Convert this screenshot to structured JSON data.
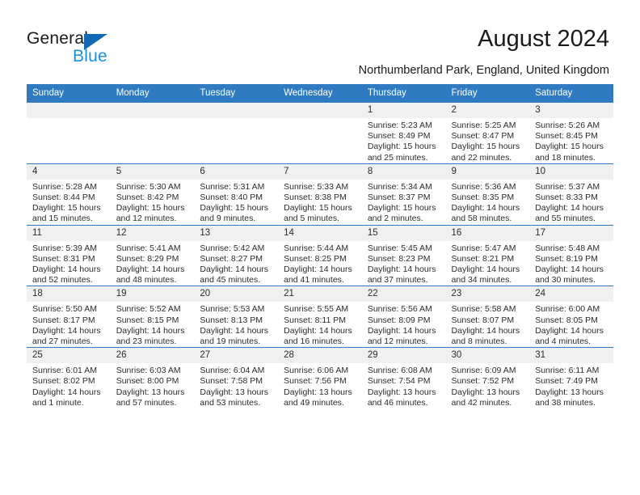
{
  "brand": {
    "word1": "General",
    "word2": "Blue",
    "triangle_color": "#1268b3",
    "blue_color": "#1a8fe0"
  },
  "header": {
    "title": "August 2024",
    "subtitle": "Northumberland Park, England, United Kingdom"
  },
  "theme": {
    "header_blue": "#2f7ac0",
    "daynum_gray": "#f0f0f0",
    "text": "#2b2b2b"
  },
  "calendar": {
    "weekday_headers": [
      "Sunday",
      "Monday",
      "Tuesday",
      "Wednesday",
      "Thursday",
      "Friday",
      "Saturday"
    ],
    "labels": {
      "sunrise": "Sunrise:",
      "sunset": "Sunset:",
      "daylight": "Daylight:"
    },
    "weeks": [
      [
        {
          "day": "",
          "empty": true
        },
        {
          "day": "",
          "empty": true
        },
        {
          "day": "",
          "empty": true
        },
        {
          "day": "",
          "empty": true
        },
        {
          "day": "1",
          "sunrise": "Sunrise: 5:23 AM",
          "sunset": "Sunset: 8:49 PM",
          "daylight_l1": "Daylight: 15 hours",
          "daylight_l2": "and 25 minutes."
        },
        {
          "day": "2",
          "sunrise": "Sunrise: 5:25 AM",
          "sunset": "Sunset: 8:47 PM",
          "daylight_l1": "Daylight: 15 hours",
          "daylight_l2": "and 22 minutes."
        },
        {
          "day": "3",
          "sunrise": "Sunrise: 5:26 AM",
          "sunset": "Sunset: 8:45 PM",
          "daylight_l1": "Daylight: 15 hours",
          "daylight_l2": "and 18 minutes."
        }
      ],
      [
        {
          "day": "4",
          "sunrise": "Sunrise: 5:28 AM",
          "sunset": "Sunset: 8:44 PM",
          "daylight_l1": "Daylight: 15 hours",
          "daylight_l2": "and 15 minutes."
        },
        {
          "day": "5",
          "sunrise": "Sunrise: 5:30 AM",
          "sunset": "Sunset: 8:42 PM",
          "daylight_l1": "Daylight: 15 hours",
          "daylight_l2": "and 12 minutes."
        },
        {
          "day": "6",
          "sunrise": "Sunrise: 5:31 AM",
          "sunset": "Sunset: 8:40 PM",
          "daylight_l1": "Daylight: 15 hours",
          "daylight_l2": "and 9 minutes."
        },
        {
          "day": "7",
          "sunrise": "Sunrise: 5:33 AM",
          "sunset": "Sunset: 8:38 PM",
          "daylight_l1": "Daylight: 15 hours",
          "daylight_l2": "and 5 minutes."
        },
        {
          "day": "8",
          "sunrise": "Sunrise: 5:34 AM",
          "sunset": "Sunset: 8:37 PM",
          "daylight_l1": "Daylight: 15 hours",
          "daylight_l2": "and 2 minutes."
        },
        {
          "day": "9",
          "sunrise": "Sunrise: 5:36 AM",
          "sunset": "Sunset: 8:35 PM",
          "daylight_l1": "Daylight: 14 hours",
          "daylight_l2": "and 58 minutes."
        },
        {
          "day": "10",
          "sunrise": "Sunrise: 5:37 AM",
          "sunset": "Sunset: 8:33 PM",
          "daylight_l1": "Daylight: 14 hours",
          "daylight_l2": "and 55 minutes."
        }
      ],
      [
        {
          "day": "11",
          "sunrise": "Sunrise: 5:39 AM",
          "sunset": "Sunset: 8:31 PM",
          "daylight_l1": "Daylight: 14 hours",
          "daylight_l2": "and 52 minutes."
        },
        {
          "day": "12",
          "sunrise": "Sunrise: 5:41 AM",
          "sunset": "Sunset: 8:29 PM",
          "daylight_l1": "Daylight: 14 hours",
          "daylight_l2": "and 48 minutes."
        },
        {
          "day": "13",
          "sunrise": "Sunrise: 5:42 AM",
          "sunset": "Sunset: 8:27 PM",
          "daylight_l1": "Daylight: 14 hours",
          "daylight_l2": "and 45 minutes."
        },
        {
          "day": "14",
          "sunrise": "Sunrise: 5:44 AM",
          "sunset": "Sunset: 8:25 PM",
          "daylight_l1": "Daylight: 14 hours",
          "daylight_l2": "and 41 minutes."
        },
        {
          "day": "15",
          "sunrise": "Sunrise: 5:45 AM",
          "sunset": "Sunset: 8:23 PM",
          "daylight_l1": "Daylight: 14 hours",
          "daylight_l2": "and 37 minutes."
        },
        {
          "day": "16",
          "sunrise": "Sunrise: 5:47 AM",
          "sunset": "Sunset: 8:21 PM",
          "daylight_l1": "Daylight: 14 hours",
          "daylight_l2": "and 34 minutes."
        },
        {
          "day": "17",
          "sunrise": "Sunrise: 5:48 AM",
          "sunset": "Sunset: 8:19 PM",
          "daylight_l1": "Daylight: 14 hours",
          "daylight_l2": "and 30 minutes."
        }
      ],
      [
        {
          "day": "18",
          "sunrise": "Sunrise: 5:50 AM",
          "sunset": "Sunset: 8:17 PM",
          "daylight_l1": "Daylight: 14 hours",
          "daylight_l2": "and 27 minutes."
        },
        {
          "day": "19",
          "sunrise": "Sunrise: 5:52 AM",
          "sunset": "Sunset: 8:15 PM",
          "daylight_l1": "Daylight: 14 hours",
          "daylight_l2": "and 23 minutes."
        },
        {
          "day": "20",
          "sunrise": "Sunrise: 5:53 AM",
          "sunset": "Sunset: 8:13 PM",
          "daylight_l1": "Daylight: 14 hours",
          "daylight_l2": "and 19 minutes."
        },
        {
          "day": "21",
          "sunrise": "Sunrise: 5:55 AM",
          "sunset": "Sunset: 8:11 PM",
          "daylight_l1": "Daylight: 14 hours",
          "daylight_l2": "and 16 minutes."
        },
        {
          "day": "22",
          "sunrise": "Sunrise: 5:56 AM",
          "sunset": "Sunset: 8:09 PM",
          "daylight_l1": "Daylight: 14 hours",
          "daylight_l2": "and 12 minutes."
        },
        {
          "day": "23",
          "sunrise": "Sunrise: 5:58 AM",
          "sunset": "Sunset: 8:07 PM",
          "daylight_l1": "Daylight: 14 hours",
          "daylight_l2": "and 8 minutes."
        },
        {
          "day": "24",
          "sunrise": "Sunrise: 6:00 AM",
          "sunset": "Sunset: 8:05 PM",
          "daylight_l1": "Daylight: 14 hours",
          "daylight_l2": "and 4 minutes."
        }
      ],
      [
        {
          "day": "25",
          "sunrise": "Sunrise: 6:01 AM",
          "sunset": "Sunset: 8:02 PM",
          "daylight_l1": "Daylight: 14 hours",
          "daylight_l2": "and 1 minute."
        },
        {
          "day": "26",
          "sunrise": "Sunrise: 6:03 AM",
          "sunset": "Sunset: 8:00 PM",
          "daylight_l1": "Daylight: 13 hours",
          "daylight_l2": "and 57 minutes."
        },
        {
          "day": "27",
          "sunrise": "Sunrise: 6:04 AM",
          "sunset": "Sunset: 7:58 PM",
          "daylight_l1": "Daylight: 13 hours",
          "daylight_l2": "and 53 minutes."
        },
        {
          "day": "28",
          "sunrise": "Sunrise: 6:06 AM",
          "sunset": "Sunset: 7:56 PM",
          "daylight_l1": "Daylight: 13 hours",
          "daylight_l2": "and 49 minutes."
        },
        {
          "day": "29",
          "sunrise": "Sunrise: 6:08 AM",
          "sunset": "Sunset: 7:54 PM",
          "daylight_l1": "Daylight: 13 hours",
          "daylight_l2": "and 46 minutes."
        },
        {
          "day": "30",
          "sunrise": "Sunrise: 6:09 AM",
          "sunset": "Sunset: 7:52 PM",
          "daylight_l1": "Daylight: 13 hours",
          "daylight_l2": "and 42 minutes."
        },
        {
          "day": "31",
          "sunrise": "Sunrise: 6:11 AM",
          "sunset": "Sunset: 7:49 PM",
          "daylight_l1": "Daylight: 13 hours",
          "daylight_l2": "and 38 minutes."
        }
      ]
    ]
  }
}
